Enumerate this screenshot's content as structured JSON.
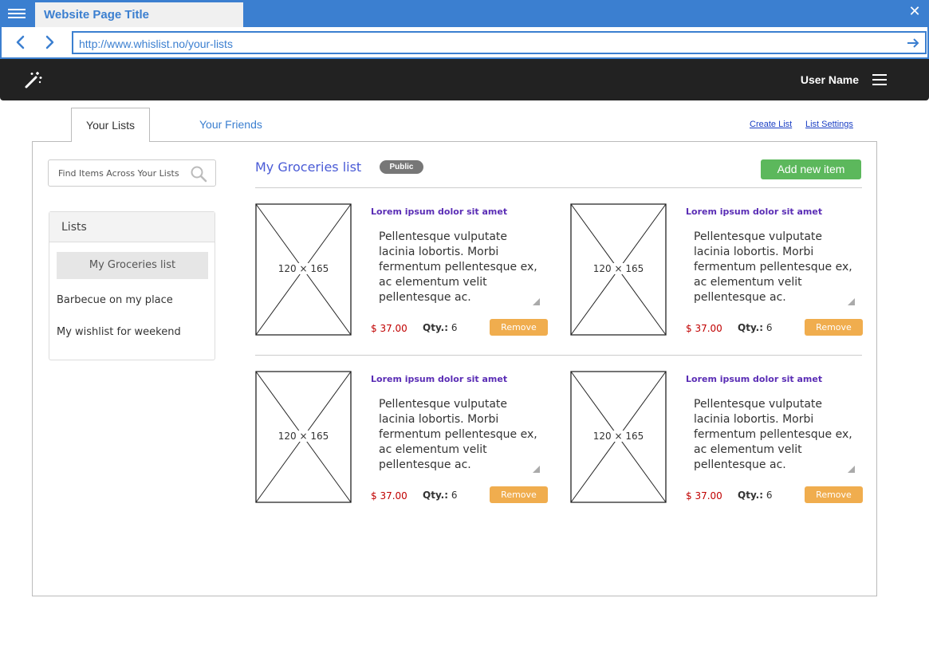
{
  "browser": {
    "tab_title": "Website Page Title",
    "url": "http://www.whislist.no/your-lists",
    "accent_color": "#3b7fd0"
  },
  "header": {
    "user_name": "User Name",
    "logo_icon": "magic-wand-icon"
  },
  "tabs": {
    "your_lists": "Your Lists",
    "your_friends": "Your Friends",
    "create_list": "Create List",
    "list_settings": "List Settings"
  },
  "sidebar": {
    "search_placeholder": "Find Items Across Your Lists",
    "lists_heading": "Lists",
    "items": [
      {
        "label": "My Groceries list",
        "active": true
      },
      {
        "label": "Barbecue on my place",
        "active": false
      },
      {
        "label": "My wishlist for weekend",
        "active": false
      }
    ]
  },
  "main": {
    "list_title": "My Groceries list",
    "visibility_badge": "Public",
    "add_button": "Add new item",
    "products": [
      {
        "image_label": "120 × 165",
        "title": "Lorem ipsum dolor sit amet",
        "description": "Pellentesque vulputate lacinia lobortis. Morbi fermentum pellentesque ex, ac elementum velit pellentesque ac.",
        "price": "$ 37.00",
        "qty_label": "Qty.:",
        "qty": "6",
        "remove_label": "Remove"
      },
      {
        "image_label": "120 × 165",
        "title": "Lorem ipsum dolor sit amet",
        "description": "Pellentesque vulputate lacinia lobortis. Morbi fermentum pellentesque ex, ac elementum velit pellentesque ac.",
        "price": "$ 37.00",
        "qty_label": "Qty.:",
        "qty": "6",
        "remove_label": "Remove"
      },
      {
        "image_label": "120 × 165",
        "title": "Lorem ipsum dolor sit amet",
        "description": "Pellentesque vulputate lacinia lobortis. Morbi fermentum pellentesque ex, ac elementum velit pellentesque ac.",
        "price": "$ 37.00",
        "qty_label": "Qty.:",
        "qty": "6",
        "remove_label": "Remove"
      },
      {
        "image_label": "120 × 165",
        "title": "Lorem ipsum dolor sit amet",
        "description": "Pellentesque vulputate lacinia lobortis. Morbi fermentum pellentesque ex, ac elementum velit pellentesque ac.",
        "price": "$ 37.00",
        "qty_label": "Qty.:",
        "qty": "6",
        "remove_label": "Remove"
      }
    ]
  },
  "colors": {
    "add_button": "#5cb85c",
    "remove_button": "#f0ad4e",
    "price": "#c00000",
    "product_title": "#5a2db5",
    "app_header": "#222222"
  }
}
